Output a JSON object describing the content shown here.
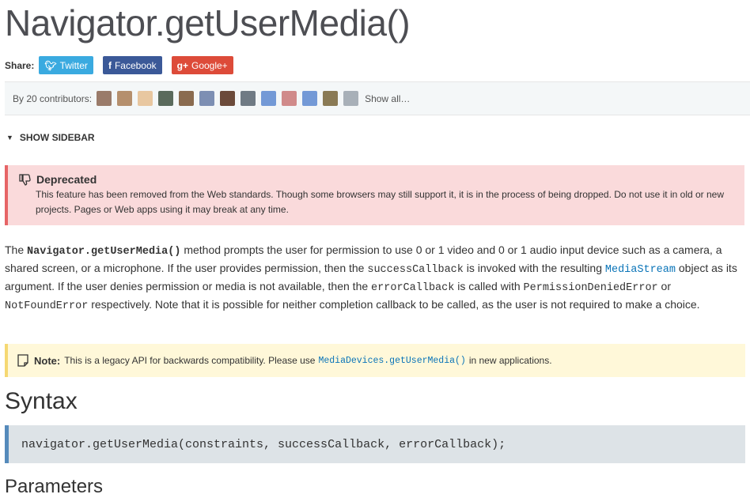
{
  "page_title": "Navigator.getUserMedia()",
  "share": {
    "label": "Share:",
    "twitter": "Twitter",
    "facebook": "Facebook",
    "googleplus": "Google+"
  },
  "contributors": {
    "label": "By 20 contributors:",
    "show_all": "Show all…",
    "avatar_colors": [
      "#9a7b6a",
      "#b58f6d",
      "#e8c7a0",
      "#5a6a5c",
      "#8a6b4f",
      "#7d8fb3",
      "#6b4a3a",
      "#6f7a84",
      "#7399d6",
      "#d08a8a",
      "#7399d6",
      "#8a7a55",
      "#a8b0b8"
    ]
  },
  "sidebar_toggle": "SHOW SIDEBAR",
  "deprecated": {
    "title": "Deprecated",
    "text": "This feature has been removed from the Web standards. Though some browsers may still support it, it is in the process of being dropped. Do not use it in old or new projects. Pages or Web apps using it may break at any time."
  },
  "intro": {
    "t1": "The ",
    "method": "Navigator.getUserMedia()",
    "t2": " method prompts the user for permission to use 0 or 1 video and 0 or 1 audio input device such as a camera, a shared screen, or a microphone. If the user provides permission, then the ",
    "success": "successCallback",
    "t3": " is invoked with the resulting ",
    "mediastream": "MediaStream",
    "t4": " object as its argument. If the user denies permission or media is not available, then the ",
    "error": "errorCallback",
    "t5": " is called with ",
    "denied": "PermissionDeniedError",
    "t6": " or ",
    "notfound": "NotFoundError",
    "t7": " respectively. Note that it is possible for neither completion callback to be called, as the user is not required to make a choice."
  },
  "note": {
    "label": "Note:",
    "t1": "This is a legacy API for backwards compatibility. Please use",
    "link": "MediaDevices.getUserMedia()",
    "t2": "in new applications."
  },
  "syntax_heading": "Syntax",
  "syntax_code": "navigator.getUserMedia(constraints, successCallback, errorCallback);",
  "parameters_heading": "Parameters",
  "colors": {
    "twitter": "#3aaae0",
    "facebook": "#3b5998",
    "googleplus": "#dd4b39",
    "deprecated_bg": "#fadadb",
    "note_bg": "#fff8d9",
    "link": "#0a74b8"
  }
}
